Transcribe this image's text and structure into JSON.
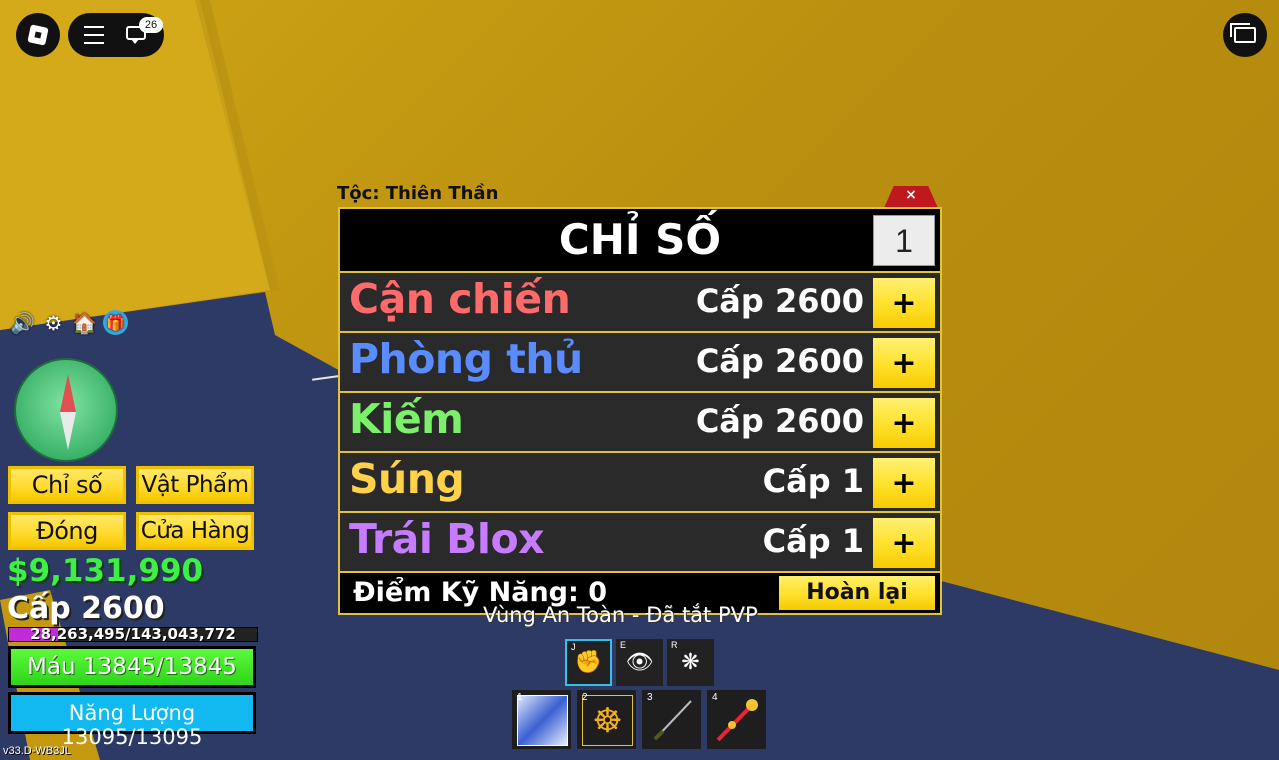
{
  "topbar": {
    "chat_badge": "26"
  },
  "stats_panel": {
    "race_label": "Tộc: Thiên Thần",
    "close_label": "×",
    "title": "CHỈ SỐ",
    "points_to_add": "1",
    "rows": [
      {
        "name": "Cận chiến",
        "level": "Cấp 2600",
        "color": "#ff6b6b"
      },
      {
        "name": "Phòng thủ",
        "level": "Cấp 2600",
        "color": "#5b8cff"
      },
      {
        "name": "Kiếm",
        "level": "Cấp 2600",
        "color": "#7cf06a"
      },
      {
        "name": "Súng",
        "level": "Cấp 1",
        "color": "#ffd24a"
      },
      {
        "name": "Trái Blox",
        "level": "Cấp 1",
        "color": "#c77cff"
      }
    ],
    "plus_label": "+",
    "skill_points": "Điểm Kỹ Năng: 0",
    "reset_label": "Hoàn lại"
  },
  "left_menu": {
    "stats_btn": "Chỉ số",
    "items_btn": "Vật Phẩm",
    "close_btn": "Đóng",
    "shop_btn": "Cửa Hàng"
  },
  "player": {
    "money": "$9,131,990",
    "level": "Cấp 2600",
    "xp": "28,263,495/143,043,772",
    "xp_fraction": 0.198,
    "health": "Máu 13845/13845",
    "health_fraction": 1.0,
    "energy": "Năng Lượng 13095/13095",
    "energy_fraction": 1.0
  },
  "zone_text": "Vùng An Toàn - Đã tắt PVP",
  "abilities": [
    {
      "key": "J",
      "icon": "fist-icon",
      "active": true
    },
    {
      "key": "E",
      "icon": "eye-icon",
      "active": false
    },
    {
      "key": "R",
      "icon": "wings-icon",
      "active": false
    }
  ],
  "hotbar": [
    {
      "num": "1",
      "icon": "fighting-style-icon"
    },
    {
      "num": "2",
      "icon": "buddha-fruit-icon"
    },
    {
      "num": "3",
      "icon": "katana-icon"
    },
    {
      "num": "4",
      "icon": "staff-icon"
    }
  ],
  "version": "v33.D-WB3JL",
  "colors": {
    "accent_yellow": "#ffdb2e",
    "panel_border": "#e2c23a",
    "money_green": "#3ef046"
  }
}
